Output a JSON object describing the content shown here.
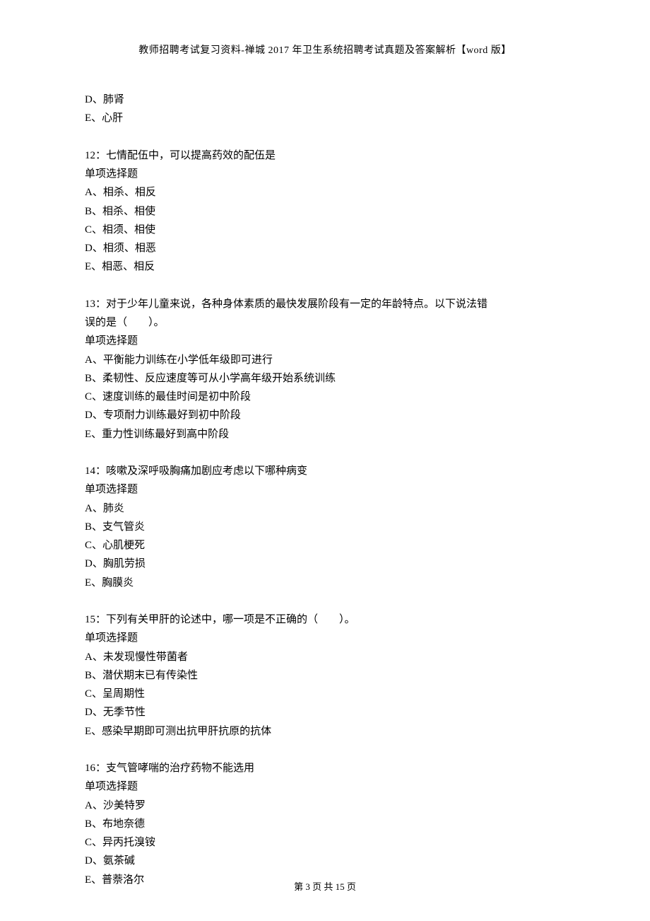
{
  "header": "教师招聘考试复习资料-禅城 2017 年卫生系统招聘考试真题及答案解析【word 版】",
  "lines": {
    "l0": "D、肺肾",
    "l1": "E、心肝",
    "q12_title": "12：七情配伍中，可以提高药效的配伍是",
    "q12_type": "单项选择题",
    "q12_a": "A、相杀、相反",
    "q12_b": "B、相杀、相使",
    "q12_c": "C、相须、相使",
    "q12_d": "D、相须、相恶",
    "q12_e": "E、相恶、相反",
    "q13_title1": "13：对于少年儿童来说，各种身体素质的最快发展阶段有一定的年龄特点。以下说法错",
    "q13_title2": "误的是（　　）。",
    "q13_type": "单项选择题",
    "q13_a": "A、平衡能力训练在小学低年级即可进行",
    "q13_b": "B、柔韧性、反应速度等可从小学高年级开始系统训练",
    "q13_c": "C、速度训练的最佳时间是初中阶段",
    "q13_d": "D、专项耐力训练最好到初中阶段",
    "q13_e": "E、重力性训练最好到高中阶段",
    "q14_title": "14：咳嗽及深呼吸胸痛加剧应考虑以下哪种病变",
    "q14_type": "单项选择题",
    "q14_a": "A、肺炎",
    "q14_b": "B、支气管炎",
    "q14_c": "C、心肌梗死",
    "q14_d": "D、胸肌劳损",
    "q14_e": "E、胸膜炎",
    "q15_title": "15：下列有关甲肝的论述中，哪一项是不正确的（　　）。",
    "q15_type": "单项选择题",
    "q15_a": "A、未发现慢性带菌者",
    "q15_b": "B、潜伏期末已有传染性",
    "q15_c": "C、呈周期性",
    "q15_d": "D、无季节性",
    "q15_e": "E、感染早期即可测出抗甲肝抗原的抗体",
    "q16_title": "16：支气管哮喘的治疗药物不能选用",
    "q16_type": "单项选择题",
    "q16_a": "A、沙美特罗",
    "q16_b": "B、布地奈德",
    "q16_c": "C、异丙托溴铵",
    "q16_d": "D、氨茶碱",
    "q16_e": "E、普萘洛尔"
  },
  "footer": "第 3 页 共 15 页"
}
